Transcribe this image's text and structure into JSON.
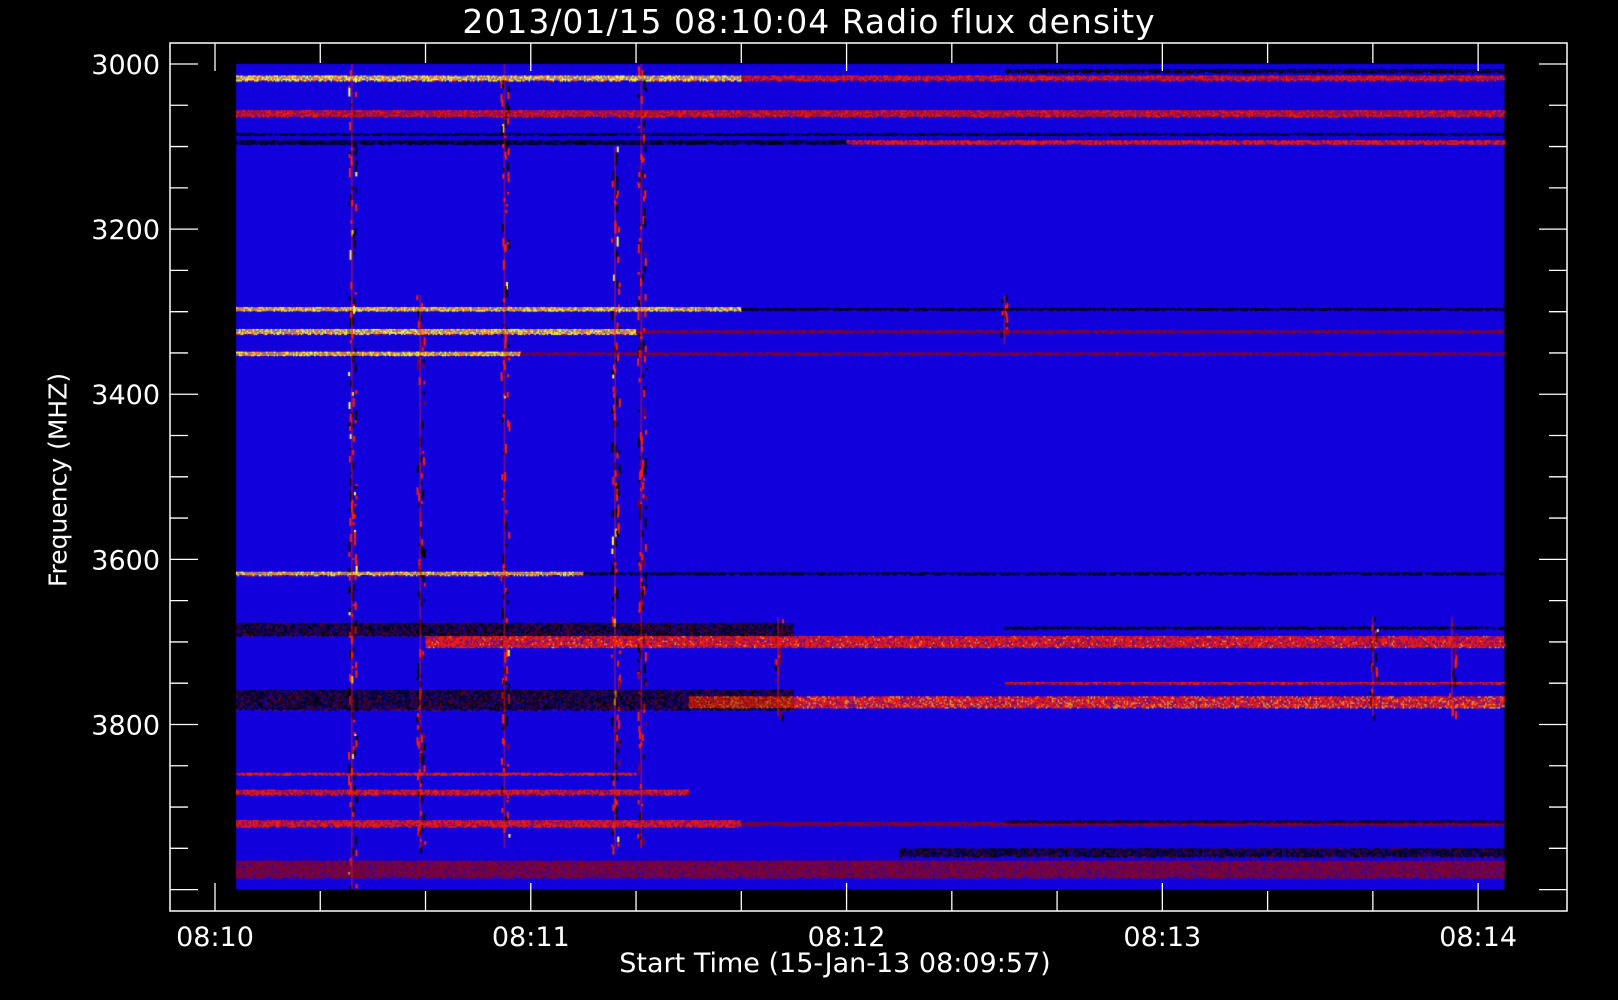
{
  "chart_data": {
    "type": "heatmap",
    "title": "2013/01/15 08:10:04 Radio flux density",
    "xlabel": "Start Time (15-Jan-13 08:09:57)",
    "ylabel": "Frequency (MHZ)",
    "x_unit": "seconds after 08:10:00",
    "xlim": [
      -5,
      255
    ],
    "data_time_range": [
      4,
      245
    ],
    "ylim": [
      4000,
      3000
    ],
    "data_freq_range": [
      3000,
      4000
    ],
    "x_ticks": [
      {
        "value": 0,
        "label": "08:10"
      },
      {
        "value": 60,
        "label": "08:11"
      },
      {
        "value": 120,
        "label": "08:12"
      },
      {
        "value": 180,
        "label": "08:13"
      },
      {
        "value": 240,
        "label": "08:14"
      }
    ],
    "x_minor_step": 20,
    "y_ticks": [
      {
        "value": 3000,
        "label": "3000"
      },
      {
        "value": 3200,
        "label": "3200"
      },
      {
        "value": 3400,
        "label": "3400"
      },
      {
        "value": 3600,
        "label": "3600"
      },
      {
        "value": 3800,
        "label": "3800"
      }
    ],
    "y_minor_step": 50,
    "colors": {
      "background": "#000000",
      "axes": "#ffffff",
      "quiet": "#1200dc",
      "low": "#8a0020",
      "mid": "#ff2000",
      "high": "#ffff40",
      "dropout": "#000000"
    },
    "bands": [
      {
        "freq": 3017,
        "width": 6,
        "t0": 4,
        "t1": 100,
        "level": 0.95
      },
      {
        "freq": 3017,
        "width": 6,
        "t0": 100,
        "t1": 245,
        "level": 0.45
      },
      {
        "freq": 3008,
        "width": 4,
        "t0": 150,
        "t1": 245,
        "level": -1
      },
      {
        "freq": 3060,
        "width": 8,
        "t0": 4,
        "t1": 245,
        "level": 0.4
      },
      {
        "freq": 3085,
        "width": 3,
        "t0": 4,
        "t1": 245,
        "level": -1
      },
      {
        "freq": 3095,
        "width": 5,
        "t0": 4,
        "t1": 120,
        "level": -1
      },
      {
        "freq": 3095,
        "width": 5,
        "t0": 120,
        "t1": 245,
        "level": 0.6
      },
      {
        "freq": 3297,
        "width": 5,
        "t0": 4,
        "t1": 100,
        "level": 0.9
      },
      {
        "freq": 3297,
        "width": 3,
        "t0": 100,
        "t1": 245,
        "level": -1
      },
      {
        "freq": 3324,
        "width": 6,
        "t0": 4,
        "t1": 80,
        "level": 0.9
      },
      {
        "freq": 3324,
        "width": 3,
        "t0": 80,
        "t1": 245,
        "level": 0.3
      },
      {
        "freq": 3351,
        "width": 5,
        "t0": 4,
        "t1": 58,
        "level": 0.95
      },
      {
        "freq": 3351,
        "width": 3,
        "t0": 58,
        "t1": 245,
        "level": 0.3
      },
      {
        "freq": 3617,
        "width": 4,
        "t0": 4,
        "t1": 70,
        "level": 0.8
      },
      {
        "freq": 3617,
        "width": 2,
        "t0": 70,
        "t1": 245,
        "level": -1
      },
      {
        "freq": 3685,
        "width": 16,
        "t0": 4,
        "t1": 110,
        "level": -0.6
      },
      {
        "freq": 3700,
        "width": 14,
        "t0": 40,
        "t1": 245,
        "level": 0.65
      },
      {
        "freq": 3683,
        "width": 3,
        "t0": 150,
        "t1": 245,
        "level": -1
      },
      {
        "freq": 3770,
        "width": 24,
        "t0": 4,
        "t1": 110,
        "level": -0.6
      },
      {
        "freq": 3773,
        "width": 14,
        "t0": 90,
        "t1": 245,
        "level": 0.75
      },
      {
        "freq": 3750,
        "width": 3,
        "t0": 150,
        "t1": 245,
        "level": 0.4
      },
      {
        "freq": 3860,
        "width": 3,
        "t0": 4,
        "t1": 80,
        "level": 0.6
      },
      {
        "freq": 3882,
        "width": 6,
        "t0": 4,
        "t1": 90,
        "level": 0.5
      },
      {
        "freq": 3920,
        "width": 8,
        "t0": 4,
        "t1": 100,
        "level": 0.6
      },
      {
        "freq": 3920,
        "width": 4,
        "t0": 100,
        "t1": 245,
        "level": 0.3
      },
      {
        "freq": 3918,
        "width": 3,
        "t0": 150,
        "t1": 245,
        "level": -1
      },
      {
        "freq": 3955,
        "width": 10,
        "t0": 130,
        "t1": 245,
        "level": -0.7
      },
      {
        "freq": 3975,
        "width": 20,
        "t0": 4,
        "t1": 245,
        "level": 0.25
      }
    ],
    "bursts": [
      {
        "time": 26,
        "f0": 3000,
        "f1": 4000,
        "level": 0.7
      },
      {
        "time": 39,
        "f0": 3280,
        "f1": 3950,
        "level": 0.5
      },
      {
        "time": 55,
        "f0": 3000,
        "f1": 3950,
        "level": 0.6
      },
      {
        "time": 76,
        "f0": 3100,
        "f1": 3950,
        "level": 0.6
      },
      {
        "time": 81,
        "f0": 3000,
        "f1": 3950,
        "level": 0.5
      },
      {
        "time": 107,
        "f0": 3670,
        "f1": 3790,
        "level": 0.4
      },
      {
        "time": 150,
        "f0": 3280,
        "f1": 3340,
        "level": 0.5
      },
      {
        "time": 220,
        "f0": 3670,
        "f1": 3790,
        "level": 0.6
      },
      {
        "time": 235,
        "f0": 3670,
        "f1": 3790,
        "level": 0.5
      }
    ]
  }
}
